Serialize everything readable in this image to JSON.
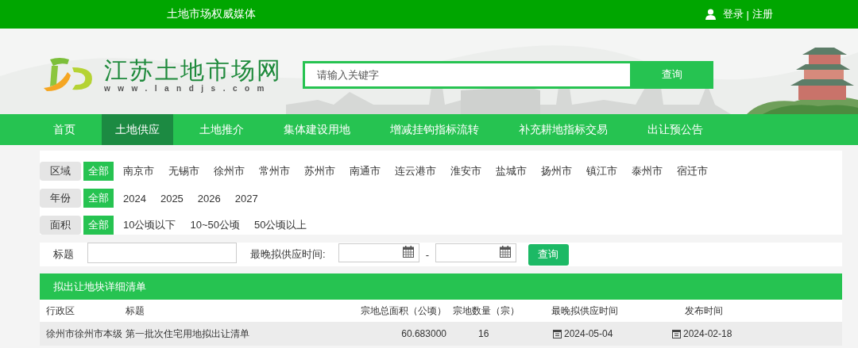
{
  "top_bar": {
    "slogan": "土地市场权威媒体",
    "login": "登录",
    "separator": "|",
    "register": "注册"
  },
  "header": {
    "logo_title": "江苏土地市场网",
    "logo_url": "www.landjs.com",
    "search": {
      "placeholder": "请输入关键字",
      "button": "查询"
    }
  },
  "nav": [
    {
      "label": "首页",
      "selected": false
    },
    {
      "label": "土地供应",
      "selected": true
    },
    {
      "label": "土地推介",
      "selected": false
    },
    {
      "label": "集体建设用地",
      "selected": false
    },
    {
      "label": "增减挂钩指标流转",
      "selected": false
    },
    {
      "label": "补充耕地指标交易",
      "selected": false
    },
    {
      "label": "出让预公告",
      "selected": false
    }
  ],
  "filters": [
    {
      "label": "区域",
      "options": [
        {
          "label": "全部",
          "selected": true
        },
        {
          "label": "南京市",
          "selected": false
        },
        {
          "label": "无锡市",
          "selected": false
        },
        {
          "label": "徐州市",
          "selected": false
        },
        {
          "label": "常州市",
          "selected": false
        },
        {
          "label": "苏州市",
          "selected": false
        },
        {
          "label": "南通市",
          "selected": false
        },
        {
          "label": "连云港市",
          "selected": false
        },
        {
          "label": "淮安市",
          "selected": false
        },
        {
          "label": "盐城市",
          "selected": false
        },
        {
          "label": "扬州市",
          "selected": false
        },
        {
          "label": "镇江市",
          "selected": false
        },
        {
          "label": "泰州市",
          "selected": false
        },
        {
          "label": "宿迁市",
          "selected": false
        }
      ]
    },
    {
      "label": "年份",
      "options": [
        {
          "label": "全部",
          "selected": true
        },
        {
          "label": "2024",
          "selected": false
        },
        {
          "label": "2025",
          "selected": false
        },
        {
          "label": "2026",
          "selected": false
        },
        {
          "label": "2027",
          "selected": false
        }
      ]
    },
    {
      "label": "面积",
      "options": [
        {
          "label": "全部",
          "selected": true
        },
        {
          "label": "10公顷以下",
          "selected": false
        },
        {
          "label": "10~50公顷",
          "selected": false
        },
        {
          "label": "50公顷以上",
          "selected": false
        }
      ]
    }
  ],
  "query": {
    "title_label": "标题",
    "date_label": "最晚拟供应时间:",
    "range_separator": "-",
    "button": "查询"
  },
  "list": {
    "title": "拟出让地块详细清单",
    "columns": [
      {
        "label": "行政区",
        "kind": "text"
      },
      {
        "label": "标题",
        "kind": "text"
      },
      {
        "label": "宗地总面积（公顷）",
        "kind": "number"
      },
      {
        "label": "宗地数量（宗）",
        "kind": "count"
      },
      {
        "label": "最晚拟供应时间",
        "kind": "date"
      },
      {
        "label": "发布时间",
        "kind": "date"
      }
    ],
    "rows": [
      [
        "徐州市徐州市本级",
        "第一批次住宅用地拟出让清单",
        "60.683000",
        "16",
        "2024-05-04",
        "2024-02-18"
      ]
    ]
  }
}
